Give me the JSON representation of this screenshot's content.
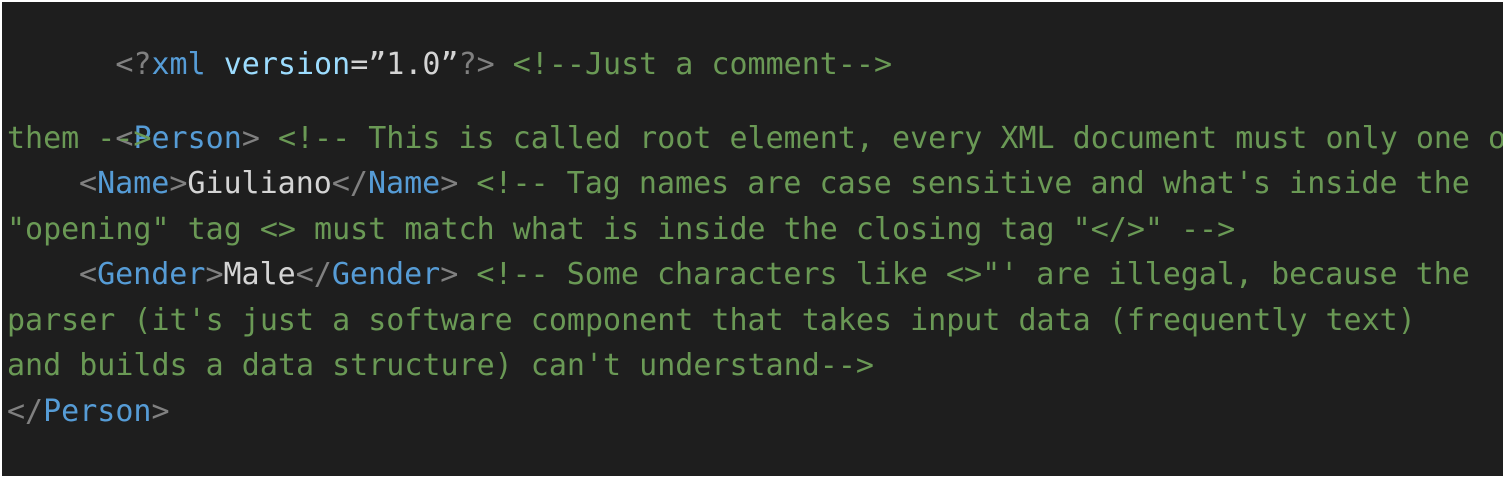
{
  "editor": {
    "lines": [
      {
        "decl_open": "<?",
        "decl_name": "xml",
        "attr_name": "version",
        "attr_eq": "=",
        "attr_value": "”1.0”",
        "decl_close": "?>",
        "comment": "<!--Just a comment-->"
      },
      {
        "open_lt": "<",
        "tag": "Person",
        "open_gt": ">",
        "comment": "<!-- This is called root element, every XML document must only one of"
      },
      {
        "comment": "them -->"
      },
      {
        "open_lt": "<",
        "tag": "Name",
        "open_gt": ">",
        "text": "Giuliano",
        "close_lt": "</",
        "close_tag": "Name",
        "close_gt": ">",
        "comment": "<!-- Tag names are case sensitive and what's inside the"
      },
      {
        "comment": "\"opening\" tag <> must match what is inside the closing tag \"</>\" -->"
      },
      {
        "open_lt": "<",
        "tag": "Gender",
        "open_gt": ">",
        "text": "Male",
        "close_lt": "</",
        "close_tag": "Gender",
        "close_gt": ">",
        "comment": "<!-- Some characters like <>\"' are illegal, because the"
      },
      {
        "comment": "parser (it's just a software component that takes input data (frequently text)"
      },
      {
        "comment": "and builds a data structure) can't understand-->"
      },
      {
        "close_lt": "</",
        "close_tag": "Person",
        "close_gt": ">"
      }
    ]
  }
}
